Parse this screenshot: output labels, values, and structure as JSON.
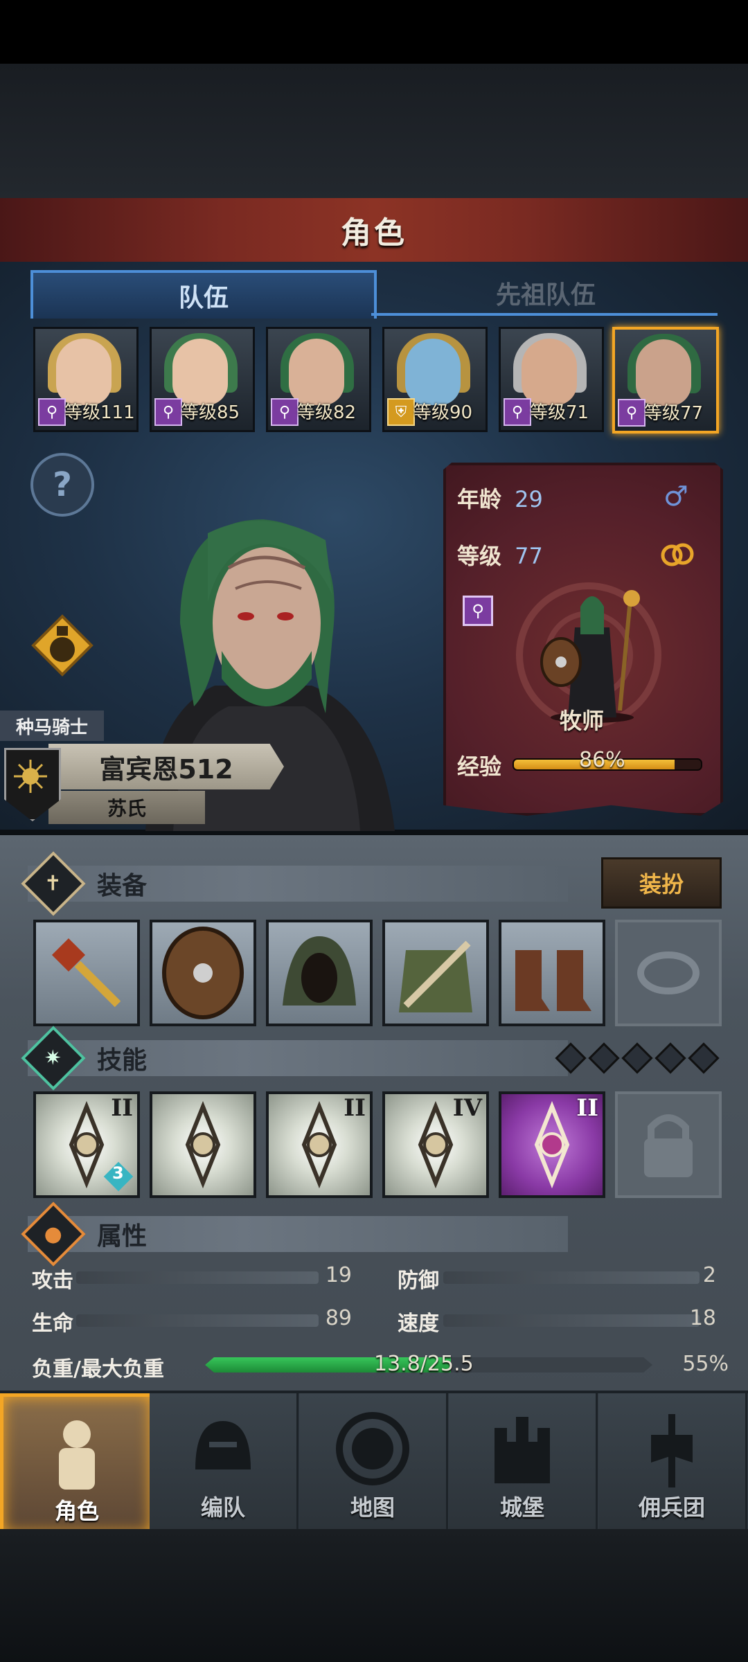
{
  "header": {
    "title": "角色"
  },
  "tabs": [
    {
      "label": "队伍",
      "active": true
    },
    {
      "label": "先祖队伍",
      "active": false
    }
  ],
  "roster": [
    {
      "level_text": "等级111",
      "class_icon": "staff-icon",
      "hair": "#c9a451",
      "skin": "#e7c2a6",
      "selected": false
    },
    {
      "level_text": "等级85",
      "class_icon": "staff-icon",
      "hair": "#3d7a4c",
      "skin": "#e7c2a6",
      "selected": false
    },
    {
      "level_text": "等级82",
      "class_icon": "staff-icon",
      "hair": "#2f6e43",
      "skin": "#d9b197",
      "selected": false
    },
    {
      "level_text": "等级90",
      "class_icon": "shield-icon",
      "hair": "#b79340",
      "skin": "#7fb3d6",
      "selected": false
    },
    {
      "level_text": "等级71",
      "class_icon": "staff-icon",
      "hair": "#b5b5b5",
      "skin": "#d6a98c",
      "selected": false
    },
    {
      "level_text": "等级77",
      "class_icon": "staff-icon",
      "hair": "#2f6a42",
      "skin": "#caa28b",
      "selected": true
    }
  ],
  "character": {
    "title": "种马骑士",
    "name": "富宾恩512",
    "surname": "苏氏",
    "age_label": "年龄",
    "age": "29",
    "level_label": "等级",
    "level": "77",
    "class_name": "牧师",
    "exp_label": "经验",
    "exp_percent": 86,
    "exp_text": "86%",
    "gender_icon": "male-symbol-icon",
    "ring_icon": "rings-icon"
  },
  "equipment": {
    "title": "装备",
    "dress_button": "装扮",
    "slots": [
      "mace-icon",
      "round-shield-icon",
      "hood-icon",
      "robe-icon",
      "boots-icon",
      "empty-ring-slot"
    ]
  },
  "skills": {
    "title": "技能",
    "gems": 5,
    "items": [
      {
        "rank": "II",
        "icon": "drop-crystal-skill-icon",
        "badge": "3",
        "purple": false
      },
      {
        "rank": "",
        "icon": "crystal-shrine-skill-icon",
        "purple": false
      },
      {
        "rank": "II",
        "icon": "crystal-hand-skill-icon",
        "purple": false
      },
      {
        "rank": "IV",
        "icon": "burst-skill-icon",
        "purple": false
      },
      {
        "rank": "II",
        "icon": "holy-cross-skill-icon",
        "purple": true
      },
      {
        "rank": "",
        "icon": "lock-icon",
        "locked": true
      }
    ]
  },
  "attributes": {
    "title": "属性",
    "attack_label": "攻击",
    "attack": "19",
    "defense_label": "防御",
    "defense": "2",
    "hp_label": "生命",
    "hp": "89",
    "speed_label": "速度",
    "speed": "18",
    "load_label": "负重/最大负重",
    "load_text": "13.8/25.5",
    "load_percent": 55,
    "load_percent_text": "55%"
  },
  "nav": [
    {
      "label": "角色",
      "icon": "knight-icon",
      "active": true
    },
    {
      "label": "编队",
      "icon": "helmet-icon",
      "active": false
    },
    {
      "label": "地图",
      "icon": "compass-icon",
      "active": false
    },
    {
      "label": "城堡",
      "icon": "castle-icon",
      "active": false
    },
    {
      "label": "佣兵团",
      "icon": "banner-icon",
      "active": false
    }
  ]
}
